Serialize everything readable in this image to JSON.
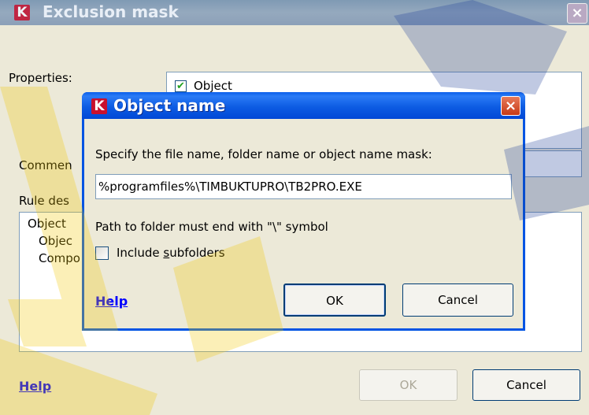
{
  "outer": {
    "title": "Exclusion mask",
    "close_glyph": "×",
    "properties_label": "Properties:",
    "property_item": "Object",
    "comment_label": "Commen",
    "rule_label": "Rule des",
    "rule_lines": [
      "Object",
      "Objec",
      "Compo"
    ],
    "help": "Help",
    "ok": "OK",
    "cancel": "Cancel"
  },
  "dialog": {
    "title": "Object name",
    "close_glyph": "×",
    "instruction": "Specify the file name, folder name or object name mask:",
    "input_value": "%programfiles%\\TIMBUKTUPRO\\TB2PRO.EXE",
    "hint": "Path to folder must end with \"\\\" symbol",
    "include_label_pre": "Include ",
    "include_label_accel": "s",
    "include_label_post": "ubfolders",
    "include_checked": false,
    "help": "Help",
    "ok": "OK",
    "cancel": "Cancel"
  },
  "icons": {
    "app_logo": "kaspersky-k-icon",
    "close": "close-icon",
    "check": "checkmark-icon"
  },
  "colors": {
    "dialog_titlebar": "#0054e3",
    "close_button": "#c73a16",
    "link": "#0000ff",
    "window_bg": "#ece9d8"
  }
}
